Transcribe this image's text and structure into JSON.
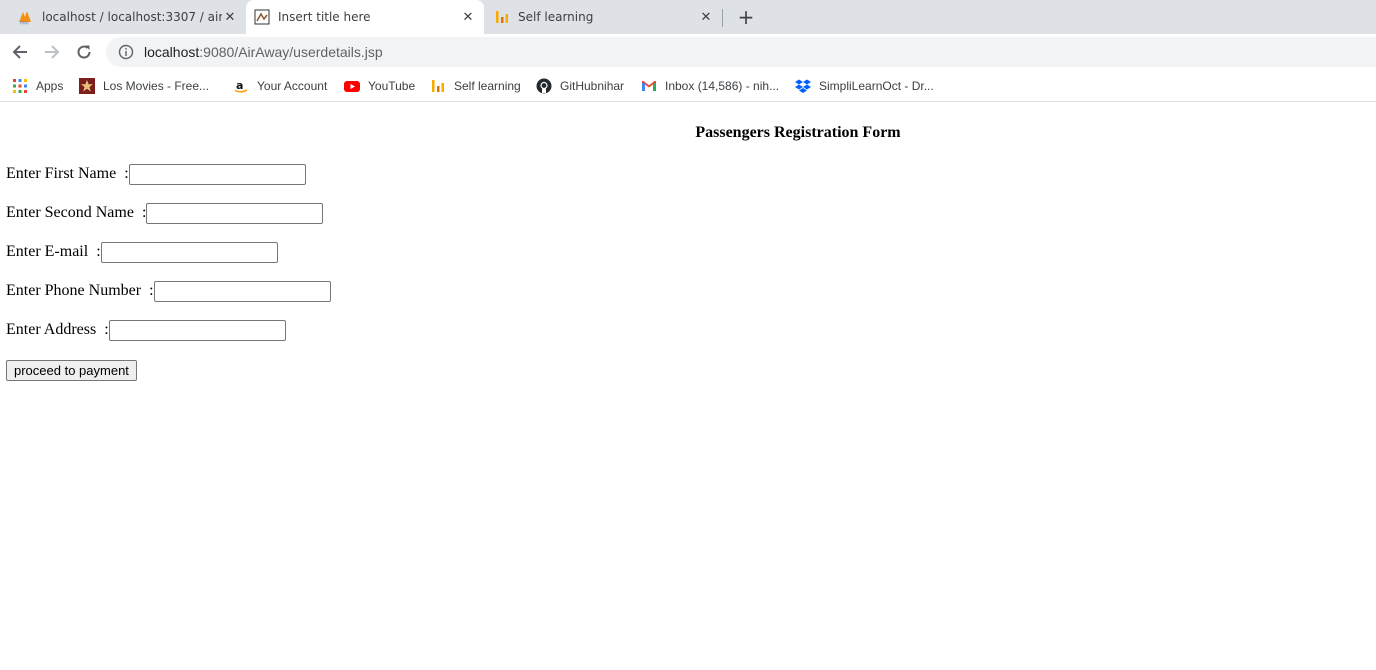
{
  "tabs": [
    {
      "title": "localhost / localhost:3307 / airaw",
      "icon": "phpmyadmin-icon"
    },
    {
      "title": "Insert title here",
      "icon": "generic-page-icon",
      "active": true
    },
    {
      "title": "Self learning",
      "icon": "analytics-icon"
    }
  ],
  "toolbar": {
    "url_host": "localhost",
    "url_path": ":9080/AirAway/userdetails.jsp"
  },
  "bookmarks": [
    {
      "label": "Apps",
      "icon": "apps-grid-icon"
    },
    {
      "label": "Los Movies - Free...",
      "icon": "star-icon"
    },
    {
      "label": "Your Account",
      "icon": "amazon-icon"
    },
    {
      "label": "YouTube",
      "icon": "youtube-icon"
    },
    {
      "label": "Self learning",
      "icon": "analytics-icon"
    },
    {
      "label": "GitHubnihar",
      "icon": "github-icon"
    },
    {
      "label": "Inbox (14,586) - nih...",
      "icon": "gmail-icon"
    },
    {
      "label": "SimpliLearnOct - Dr...",
      "icon": "dropbox-icon"
    }
  ],
  "form": {
    "title": "Passengers Registration Form",
    "fields": [
      {
        "label": "Enter First Name  :",
        "value": ""
      },
      {
        "label": "Enter Second Name  :",
        "value": ""
      },
      {
        "label": "Enter E-mail  :",
        "value": ""
      },
      {
        "label": "Enter Phone Number  :",
        "value": ""
      },
      {
        "label": "Enter Address  :",
        "value": ""
      }
    ],
    "submit_label": "proceed to payment"
  }
}
